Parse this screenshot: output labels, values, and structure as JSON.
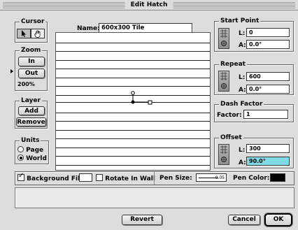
{
  "window": {
    "title": "Edit Hatch"
  },
  "cursor": {
    "title": "Cursor",
    "tools": [
      {
        "icon": "arrow-icon"
      },
      {
        "icon": "hand-icon"
      }
    ]
  },
  "zoom": {
    "title": "Zoom",
    "in_label": "In",
    "out_label": "Out",
    "value": "200%"
  },
  "layer": {
    "title": "Layer",
    "add_label": "Add",
    "remove_label": "Remove"
  },
  "units": {
    "title": "Units",
    "options": [
      "Page",
      "World"
    ],
    "selected": "World"
  },
  "name": {
    "label": "Name:",
    "value": "600x300 Tile"
  },
  "start_point": {
    "title": "Start Point",
    "l_label": "L:",
    "l_value": "0",
    "a_label": "A:",
    "a_value": "0.0°"
  },
  "repeat": {
    "title": "Repeat",
    "l_label": "L:",
    "l_value": "600",
    "a_label": "A:",
    "a_value": "0.0°"
  },
  "dash_factor": {
    "title": "Dash Factor",
    "label": "Factor:",
    "value": "1"
  },
  "offset": {
    "title": "Offset",
    "l_label": "L:",
    "l_value": "300",
    "a_label": "A:",
    "a_value": "90.0°"
  },
  "options": {
    "background_fill_label": "Background Fill:",
    "background_fill_checked": true,
    "rotate_in_wall_label": "Rotate In Wall",
    "rotate_in_wall_checked": false,
    "pen_size_label": "Pen Size:",
    "pen_size_value": "0.05",
    "pen_color_label": "Pen Color:",
    "pen_color": "#000000"
  },
  "buttons": {
    "revert": "Revert",
    "cancel": "Cancel",
    "ok": "OK"
  },
  "colors": {
    "highlight_field": "#7fdbe6"
  }
}
